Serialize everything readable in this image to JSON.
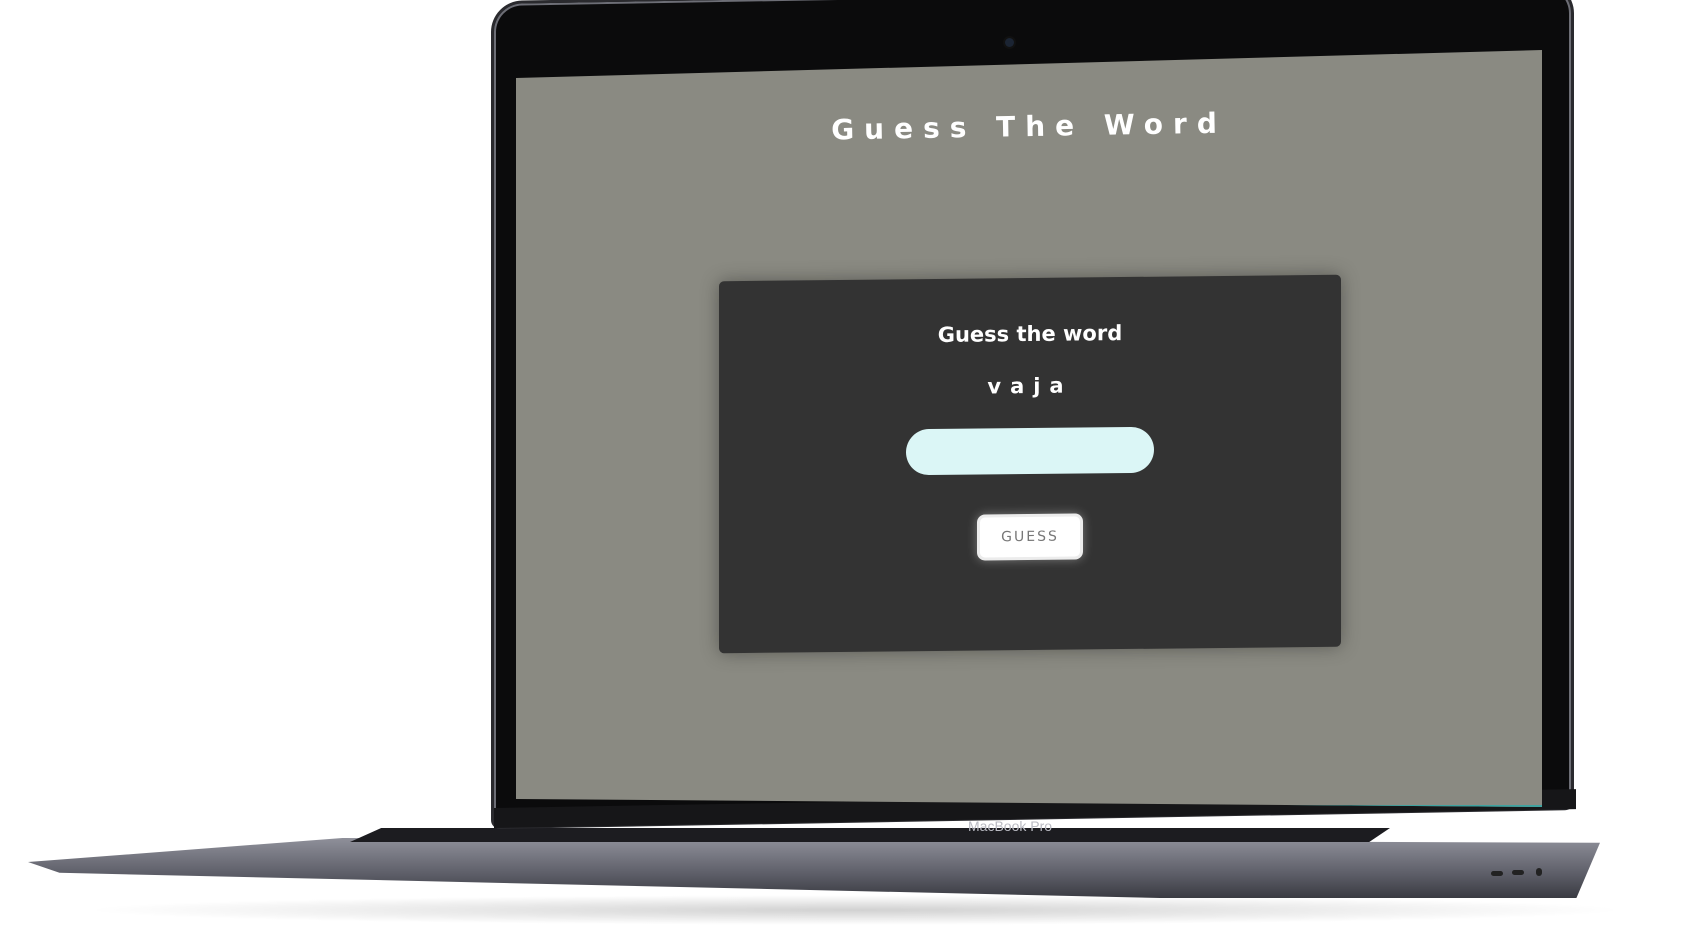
{
  "device": {
    "brand_label": "MacBook Pro"
  },
  "app": {
    "title": "Guess The Word",
    "background_color": "#8a8a82",
    "card_color": "#333333"
  },
  "game": {
    "heading": "Guess the word",
    "scrambled_word": "vaja",
    "input": {
      "value": "",
      "placeholder": ""
    },
    "guess_button_label": "GUESS"
  }
}
